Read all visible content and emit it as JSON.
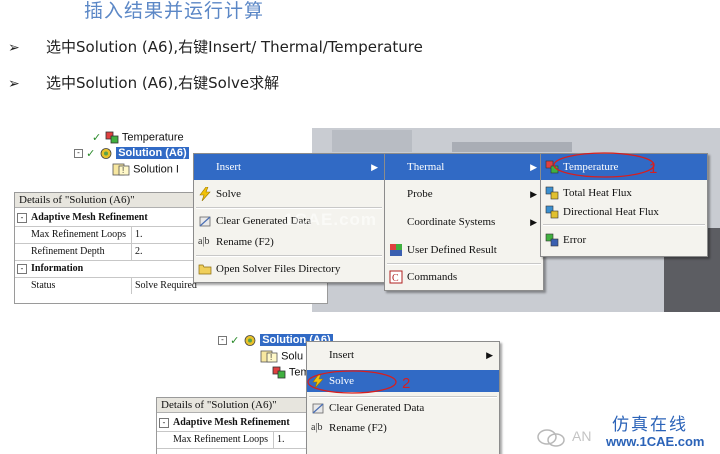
{
  "heading": "插入结果并运行计算",
  "bullets": [
    {
      "marker": "➢",
      "text": "选中Solution (A6),右键Insert/ Thermal/Temperature"
    },
    {
      "marker": "➢",
      "text": "选中Solution (A6),右键Solve求解"
    }
  ],
  "shot1": {
    "tree": {
      "temperature": "Temperature",
      "solution": "Solution (A6)",
      "solution_info": "Solution I"
    },
    "details": {
      "header": "Details of \"Solution (A6)\"",
      "section1": "Adaptive Mesh Refinement",
      "rows": [
        {
          "label": "Max Refinement Loops",
          "value": "1."
        },
        {
          "label": "Refinement Depth",
          "value": "2."
        }
      ],
      "section2": "Information",
      "status_label": "Status",
      "status_value": "Solve Required"
    },
    "menu": {
      "insert": "Insert",
      "solve": "Solve",
      "clear": "Clear Generated Data",
      "rename": "Rename (F2)",
      "open_dir": "Open Solver Files Directory"
    },
    "submenu": {
      "thermal": "Thermal",
      "probe": "Probe",
      "coord": "Coordinate Systems",
      "user_defined": "User Defined Result",
      "commands": "Commands"
    },
    "thermal_menu": {
      "temperature": "Temperature",
      "total_heat_flux": "Total Heat Flux",
      "directional_heat_flux": "Directional Heat Flux",
      "error": "Error"
    },
    "callout": "1",
    "watermark": "1CAE.com"
  },
  "shot2": {
    "tree": {
      "solution": "Solution (A6)",
      "solu": "Solu",
      "tem": "Tem"
    },
    "menu": {
      "insert": "Insert",
      "solve": "Solve",
      "clear": "Clear Generated Data",
      "rename": "Rename (F2)"
    },
    "details": {
      "header": "Details of \"Solution (A6)\"",
      "section1": "Adaptive Mesh Refinement",
      "row_label": "Max Refinement Loops",
      "row_value": "1."
    },
    "callout": "2"
  },
  "footer": {
    "brand_cn": "仿真在线",
    "site": "www.1CAE.com",
    "logo_text": "AN"
  },
  "colors": {
    "heading": "#5b87c6",
    "menu_highlight": "#316ac5",
    "callout": "#d61f1f",
    "footer": "#2b63b8"
  }
}
